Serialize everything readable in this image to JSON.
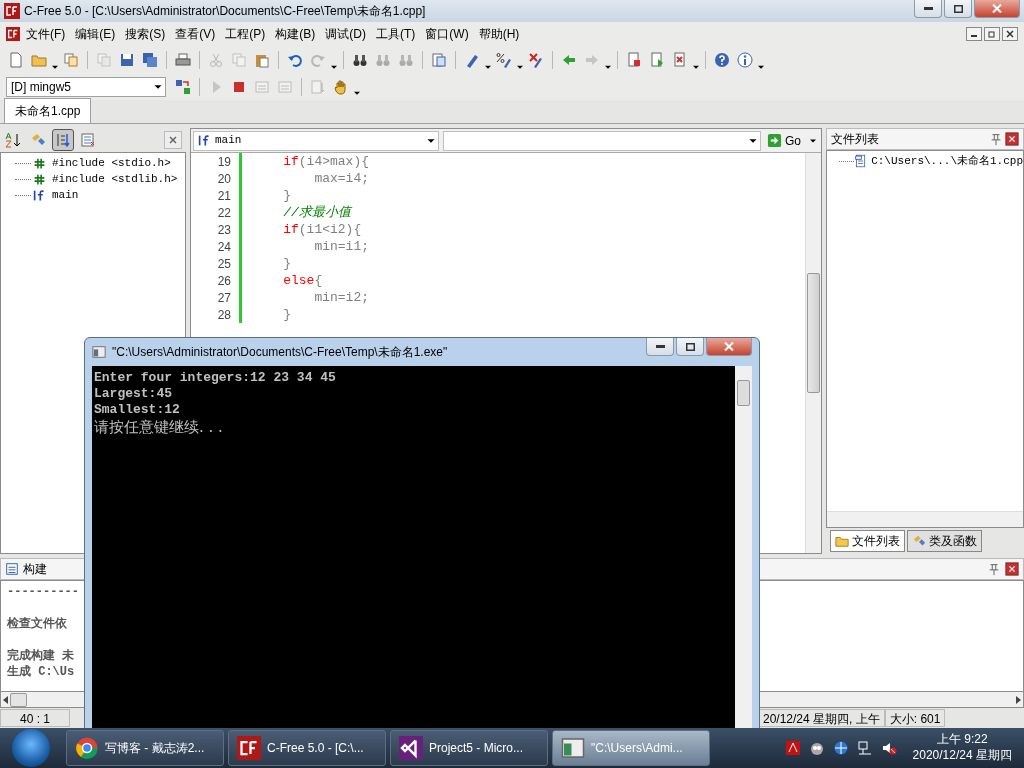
{
  "window": {
    "title": "C-Free 5.0 - [C:\\Users\\Administrator\\Documents\\C-Free\\Temp\\未命名1.cpp]"
  },
  "menu": [
    "文件(F)",
    "编辑(E)",
    "搜索(S)",
    "查看(V)",
    "工程(P)",
    "构建(B)",
    "调试(D)",
    "工具(T)",
    "窗口(W)",
    "帮助(H)"
  ],
  "toolbars": [
    [
      {
        "kind": "page",
        "disabled": false
      },
      {
        "kind": "folder",
        "disabled": false
      },
      {
        "kind": "caret"
      },
      {
        "kind": "project",
        "disabled": false
      },
      {
        "kind": "sep"
      },
      {
        "kind": "project",
        "disabled": true
      },
      {
        "kind": "save",
        "disabled": false
      },
      {
        "kind": "save-all",
        "disabled": false
      },
      {
        "kind": "sep"
      },
      {
        "kind": "print",
        "disabled": false
      },
      {
        "kind": "sep"
      },
      {
        "kind": "scissors",
        "disabled": true
      },
      {
        "kind": "copy",
        "disabled": true
      },
      {
        "kind": "clipboard",
        "disabled": false
      },
      {
        "kind": "sep"
      },
      {
        "kind": "undo",
        "disabled": false
      },
      {
        "kind": "redo",
        "disabled": true
      },
      {
        "kind": "caret"
      },
      {
        "kind": "sep"
      },
      {
        "kind": "binoculars",
        "disabled": false
      },
      {
        "kind": "binoculars",
        "disabled": true
      },
      {
        "kind": "binoculars",
        "disabled": true
      },
      {
        "kind": "sep"
      },
      {
        "kind": "replace",
        "disabled": false
      },
      {
        "kind": "sep"
      },
      {
        "kind": "pen",
        "disabled": false
      },
      {
        "kind": "caret"
      },
      {
        "kind": "percent",
        "disabled": false
      },
      {
        "kind": "caret"
      },
      {
        "kind": "pen-cross",
        "disabled": false
      },
      {
        "kind": "sep"
      },
      {
        "kind": "arrow-left",
        "disabled": false
      },
      {
        "kind": "arrow-right",
        "disabled": true
      },
      {
        "kind": "caret"
      },
      {
        "kind": "sep"
      },
      {
        "kind": "doc-red",
        "disabled": false
      },
      {
        "kind": "doc-green",
        "disabled": false
      },
      {
        "kind": "doc-cross",
        "disabled": false
      },
      {
        "kind": "caret"
      },
      {
        "kind": "sep"
      },
      {
        "kind": "help",
        "disabled": false
      },
      {
        "kind": "info",
        "disabled": false
      },
      {
        "kind": "caret"
      }
    ],
    [
      {
        "kind": "rebuild",
        "disabled": false
      },
      {
        "kind": "sep"
      },
      {
        "kind": "play",
        "disabled": true
      },
      {
        "kind": "stop",
        "disabled": false
      },
      {
        "kind": "binary",
        "disabled": true
      },
      {
        "kind": "binary",
        "disabled": true
      },
      {
        "kind": "sep"
      },
      {
        "kind": "doc-arrow",
        "disabled": true
      },
      {
        "kind": "hand",
        "disabled": false
      },
      {
        "kind": "caret"
      }
    ]
  ],
  "compiler_select": {
    "value": "[D] mingw5"
  },
  "doc_tabs": [
    {
      "label": "未命名1.cpp",
      "selected": true
    }
  ],
  "class_panel": {
    "tools": [
      {
        "kind": "sort-az",
        "selected": false
      },
      {
        "kind": "pencil-tag",
        "selected": false
      },
      {
        "kind": "list-arrow",
        "selected": true
      },
      {
        "kind": "checklist",
        "selected": false
      }
    ],
    "tree": [
      {
        "kind": "include",
        "label": "#include <stdio.h>"
      },
      {
        "kind": "include",
        "label": "#include <stdlib.h>"
      },
      {
        "kind": "function",
        "label": "main"
      }
    ]
  },
  "editor": {
    "function_select": "main",
    "go_button": "Go",
    "lines": [
      {
        "number": "19",
        "tokens": [
          {
            "kind": "keyword",
            "text": "    if"
          },
          {
            "kind": "plain",
            "text": "(i4>max){"
          }
        ]
      },
      {
        "number": "20",
        "tokens": [
          {
            "kind": "plain",
            "text": "        max=i4;"
          }
        ]
      },
      {
        "number": "21",
        "tokens": [
          {
            "kind": "plain",
            "text": "    }"
          }
        ]
      },
      {
        "number": "22",
        "tokens": [
          {
            "kind": "comment",
            "text": "    //求最小值"
          }
        ]
      },
      {
        "number": "23",
        "tokens": [
          {
            "kind": "keyword",
            "text": "    if"
          },
          {
            "kind": "plain",
            "text": "(i1<i2){"
          }
        ]
      },
      {
        "number": "24",
        "tokens": [
          {
            "kind": "plain",
            "text": "        min=i1;"
          }
        ]
      },
      {
        "number": "25",
        "tokens": [
          {
            "kind": "plain",
            "text": "    }"
          }
        ]
      },
      {
        "number": "26",
        "tokens": [
          {
            "kind": "keyword",
            "text": "    else"
          },
          {
            "kind": "plain",
            "text": "{"
          }
        ]
      },
      {
        "number": "27",
        "tokens": [
          {
            "kind": "plain",
            "text": "        min=i2;"
          }
        ]
      },
      {
        "number": "28",
        "tokens": [
          {
            "kind": "plain",
            "text": "    }"
          }
        ]
      }
    ]
  },
  "file_panel": {
    "title": "文件列表",
    "tree": [
      {
        "label": "C:\\Users\\...\\未命名1.cpp"
      }
    ],
    "tabs": [
      {
        "label": "文件列表",
        "selected": true
      },
      {
        "label": "类及函数",
        "selected": false
      }
    ]
  },
  "build_panel": {
    "title": "构建",
    "lines": [
      {
        "kind": "text",
        "text": "----------"
      },
      {
        "kind": "blank"
      },
      {
        "kind": "text",
        "text": "检查文件依"
      },
      {
        "kind": "blank"
      },
      {
        "kind": "text",
        "text": "完成构建 未"
      },
      {
        "kind": "text",
        "text": "生成 C:\\Us"
      }
    ]
  },
  "status_bar": {
    "position": "40 : 1",
    "date": "20/12/24 星期四, 上午",
    "size": "大小: 601"
  },
  "console": {
    "title": "\"C:\\Users\\Administrator\\Documents\\C-Free\\Temp\\未命名1.exe\"",
    "lines": [
      {
        "kind": "ascii",
        "text": "Enter four integers:12 23 34 45"
      },
      {
        "kind": "ascii",
        "text": "Largest:45"
      },
      {
        "kind": "ascii",
        "text": "Smallest:12"
      },
      {
        "kind": "cjk",
        "text": "请按任意键继续. . ."
      }
    ]
  },
  "taskbar": {
    "tasks": [
      {
        "kind": "browser",
        "label": "写博客 - 戴志涛2...",
        "selected": false
      },
      {
        "kind": "cfree",
        "label": "C-Free 5.0 - [C:\\...",
        "selected": false
      },
      {
        "kind": "studio",
        "label": "Project5 - Micro...",
        "selected": false
      },
      {
        "kind": "console",
        "label": "\"C:\\Users\\Admi...",
        "selected": true
      }
    ],
    "clock": {
      "time": "上午 9:22",
      "date": "2020/12/24 星期四"
    }
  }
}
